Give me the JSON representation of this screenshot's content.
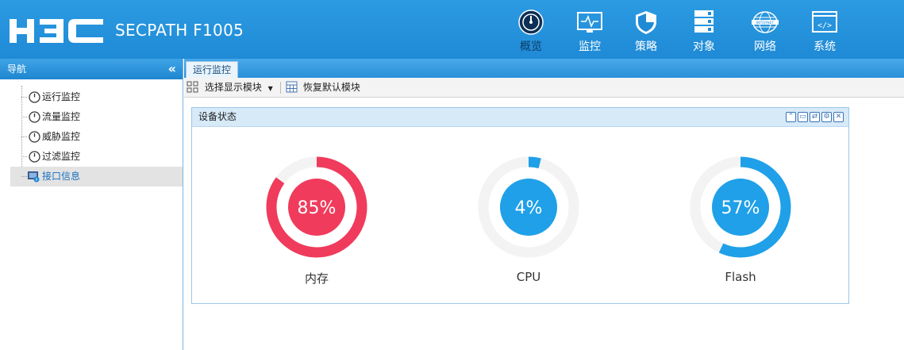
{
  "header": {
    "logo_text": "H3C",
    "product_name": "SECPATH F1005",
    "nav": [
      {
        "label": "概览",
        "icon": "dashboard-gauge-icon",
        "active": true
      },
      {
        "label": "监控",
        "icon": "monitor-icon",
        "active": false
      },
      {
        "label": "策略",
        "icon": "shield-icon",
        "active": false
      },
      {
        "label": "对象",
        "icon": "server-stack-icon",
        "active": false
      },
      {
        "label": "网络",
        "icon": "internet-globe-icon",
        "active": false
      },
      {
        "label": "系统",
        "icon": "code-window-icon",
        "active": false
      }
    ]
  },
  "sidebar": {
    "title": "导航",
    "collapse_glyph": "«",
    "items": [
      {
        "label": "运行监控",
        "icon": "gauge-icon",
        "selected": false
      },
      {
        "label": "流量监控",
        "icon": "gauge-icon",
        "selected": false
      },
      {
        "label": "威胁监控",
        "icon": "gauge-icon",
        "selected": false
      },
      {
        "label": "过滤监控",
        "icon": "gauge-icon",
        "selected": false
      },
      {
        "label": "接口信息",
        "icon": "interface-info-icon",
        "selected": true
      }
    ]
  },
  "main": {
    "tab_label": "运行监控",
    "toolbar": {
      "select_modules": "选择显示模块",
      "restore_default": "恢复默认模块"
    },
    "panel": {
      "title": "设备状态",
      "tools": [
        "collapse-up-icon",
        "maximize-icon",
        "refresh-icon",
        "settings-icon",
        "close-icon"
      ]
    },
    "gauges": [
      {
        "label": "内存",
        "value": 85,
        "display": "85%",
        "color": "#f03b5c"
      },
      {
        "label": "CPU",
        "value": 4,
        "display": "4%",
        "color": "#1fa0e8"
      },
      {
        "label": "Flash",
        "value": 57,
        "display": "57%",
        "color": "#1fa0e8"
      }
    ]
  },
  "colors": {
    "header_blue": "#2196df",
    "memory_red": "#f03b5c",
    "usage_blue": "#1fa0e8",
    "track_gray": "#efefef"
  }
}
